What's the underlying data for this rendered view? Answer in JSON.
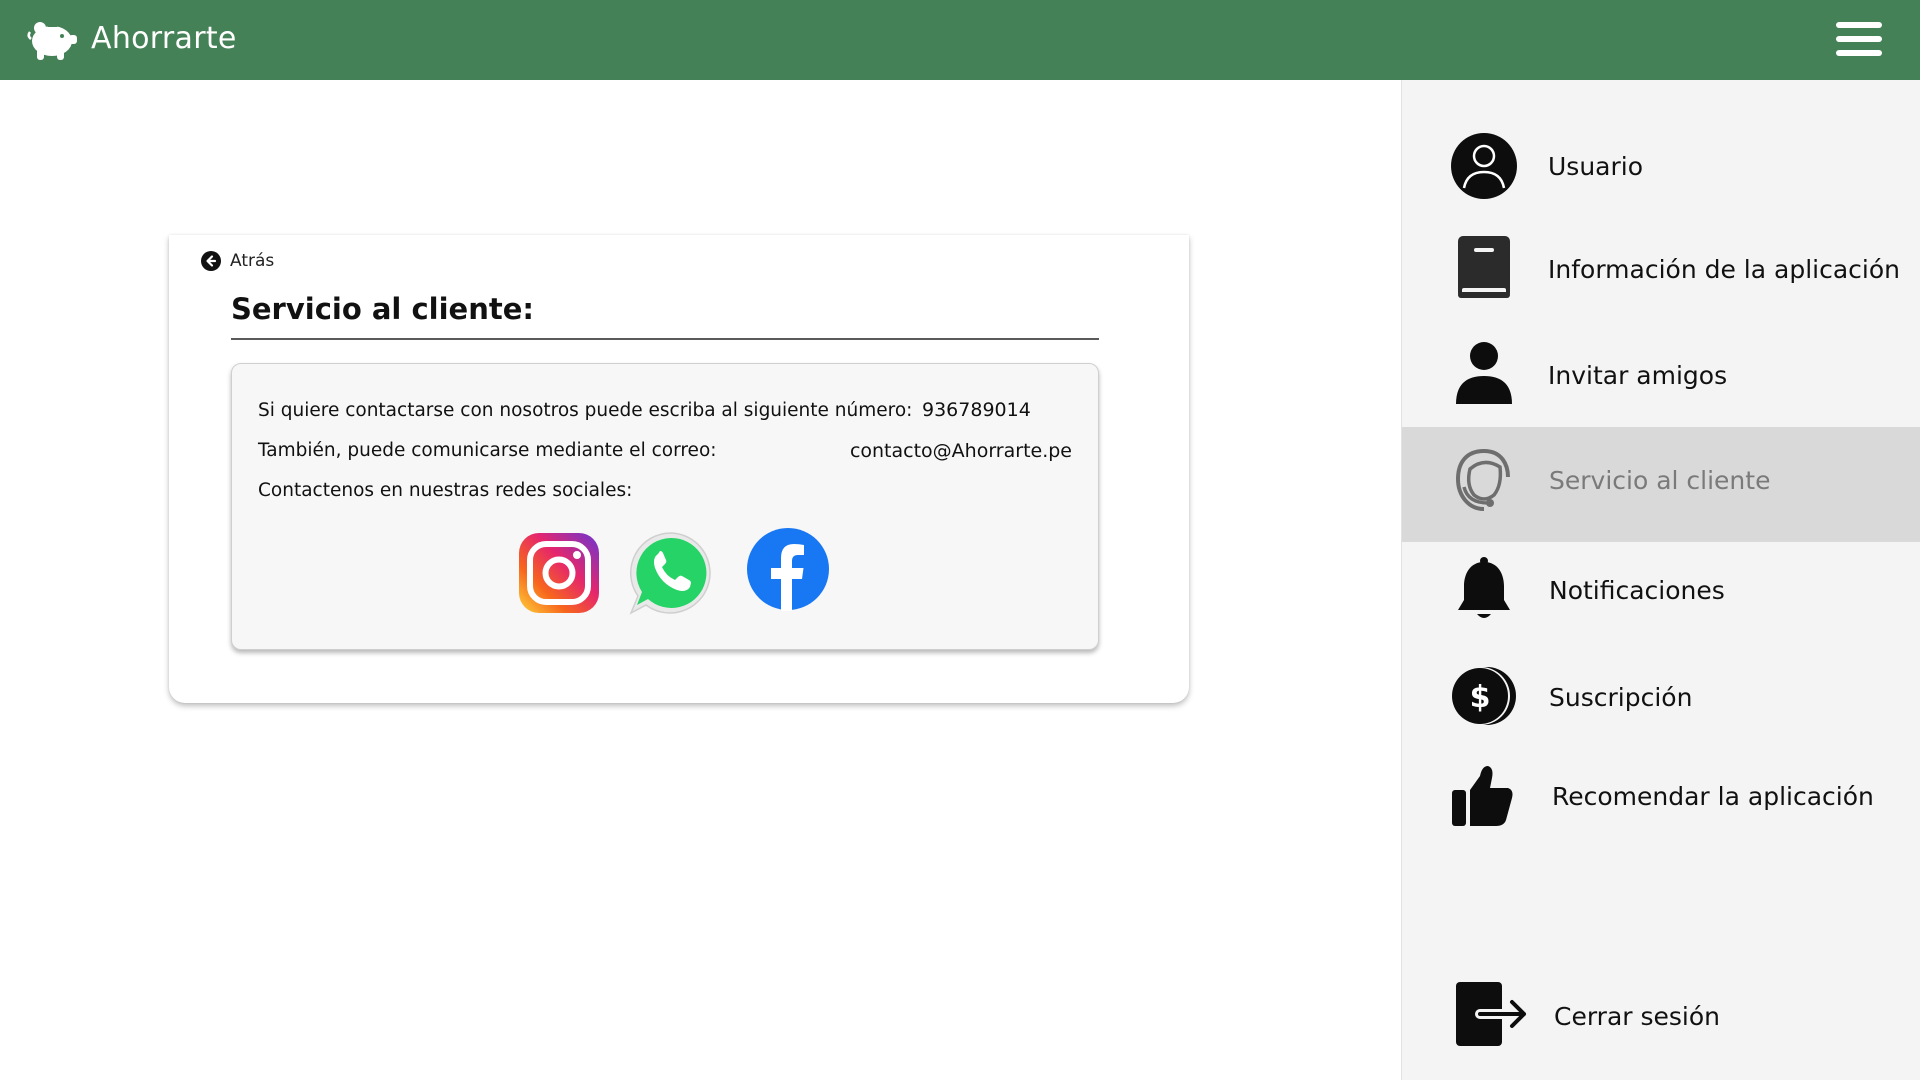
{
  "app": {
    "name": "Ahorrarte",
    "brand_color": "#448156",
    "logo_icon": "piggy-bank-icon"
  },
  "header": {
    "menu_icon": "hamburger-menu-icon"
  },
  "content": {
    "back_label": "Atrás",
    "title": "Servicio al cliente:",
    "phone_text": "Si quiere contactarse con nosotros puede escriba al siguiente número:",
    "phone_number": "936789014",
    "email_text": "También, puede comunicarse mediante el correo:",
    "email": "contacto@Ahorrarte.pe",
    "social_text": "Contactenos en nuestras redes sociales:",
    "social": [
      "instagram-icon",
      "whatsapp-icon",
      "facebook-icon"
    ]
  },
  "sidebar": {
    "items": [
      {
        "label": "Usuario",
        "icon": "user-circle-icon"
      },
      {
        "label": "Información de la aplicación",
        "icon": "book-icon"
      },
      {
        "label": "Invitar amigos",
        "icon": "person-icon"
      },
      {
        "label": "Servicio al cliente",
        "icon": "headset-icon",
        "active": true
      },
      {
        "label": "Notificaciones",
        "icon": "bell-icon"
      },
      {
        "label": "Suscripción",
        "icon": "dollar-coin-icon"
      },
      {
        "label": "Recomendar la aplicación",
        "icon": "thumbs-up-icon"
      },
      {
        "label": "Cerrar sesión",
        "icon": "logout-icon"
      }
    ],
    "active_bg": "#d9d9d9"
  }
}
